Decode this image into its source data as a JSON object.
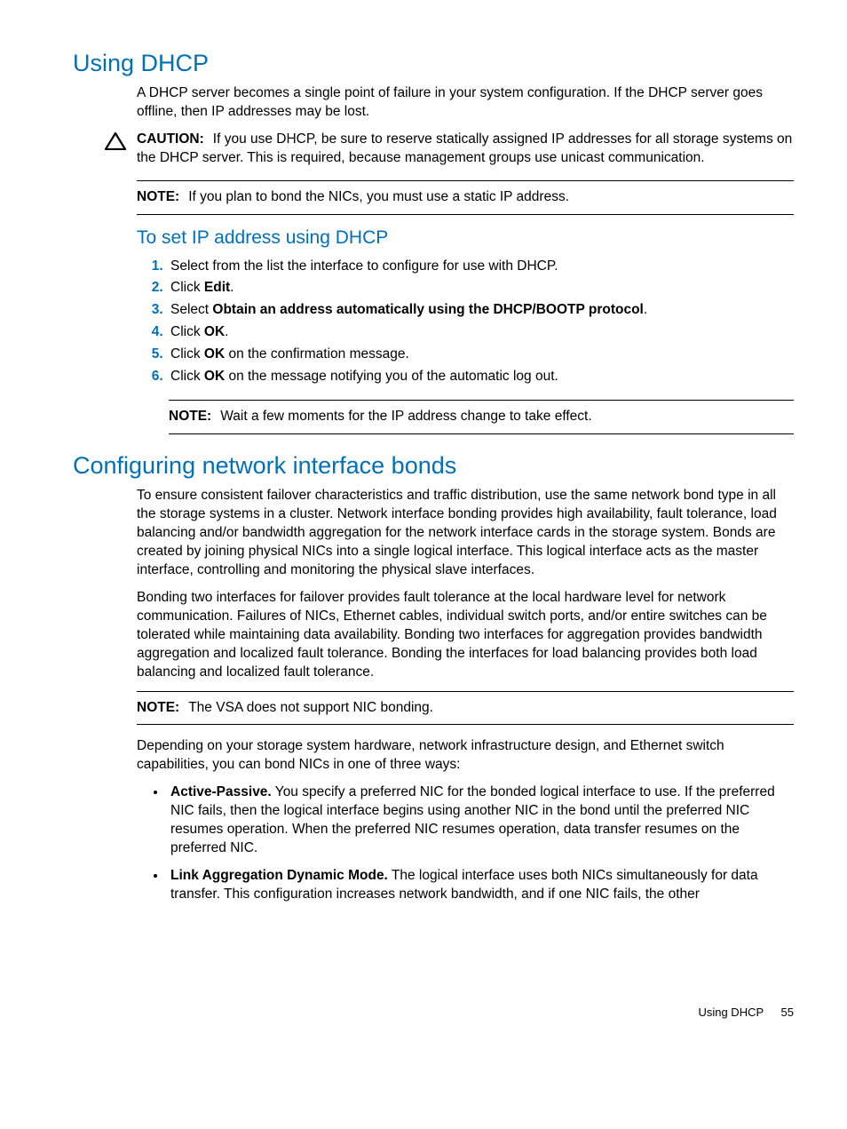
{
  "section1": {
    "heading": "Using DHCP",
    "intro": "A DHCP server becomes a single point of failure in your system configuration. If the DHCP server goes offline, then IP addresses may be lost.",
    "caution_label": "CAUTION:",
    "caution_text": "If you use DHCP, be sure to reserve statically assigned IP addresses for all storage systems on the DHCP server. This is required, because management groups use unicast communication.",
    "note1_label": "NOTE:",
    "note1_text": "If you plan to bond the NICs, you must use a static IP address.",
    "subheading": "To set IP address using DHCP",
    "steps": {
      "s1": "Select from the list the interface to configure for use with DHCP.",
      "s2a": "Click ",
      "s2b": "Edit",
      "s2c": ".",
      "s3a": "Select ",
      "s3b": "Obtain an address automatically using the DHCP/BOOTP protocol",
      "s3c": ".",
      "s4a": "Click ",
      "s4b": "OK",
      "s4c": ".",
      "s5a": "Click ",
      "s5b": "OK",
      "s5c": " on the confirmation message.",
      "s6a": "Click ",
      "s6b": "OK",
      "s6c": " on the message notifying you of the automatic log out."
    },
    "note2_label": "NOTE:",
    "note2_text": "Wait a few moments for the IP address change to take effect."
  },
  "section2": {
    "heading": "Configuring network interface bonds",
    "p1": "To ensure consistent failover characteristics and traffic distribution, use the same network bond type in all the storage systems in a cluster. Network interface bonding provides high availability, fault tolerance, load balancing and/or bandwidth aggregation for the network interface cards in the storage system. Bonds are created by joining physical NICs into a single logical interface. This logical interface acts as the master interface, controlling and monitoring the physical slave interfaces.",
    "p2": "Bonding two interfaces for failover provides fault tolerance at the local hardware level for network communication. Failures of NICs, Ethernet cables, individual switch ports, and/or entire switches can be tolerated while maintaining data availability. Bonding two interfaces for aggregation provides bandwidth aggregation and localized fault tolerance. Bonding the interfaces for load balancing provides both load balancing and localized fault tolerance.",
    "note_label": "NOTE:",
    "note_text": "The VSA does not support NIC bonding.",
    "p3": "Depending on your storage system hardware, network infrastructure design, and Ethernet switch capabilities, you can bond NICs in one of three ways:",
    "bullets": {
      "b1_label": "Active-Passive.",
      "b1_text": " You specify a preferred NIC for the bonded logical interface to use. If the preferred NIC fails, then the logical interface begins using another NIC in the bond until the preferred NIC resumes operation. When the preferred NIC resumes operation, data transfer resumes on the preferred NIC.",
      "b2_label": "Link Aggregation Dynamic Mode.",
      "b2_text": " The logical interface uses both NICs simultaneously for data transfer. This configuration increases network bandwidth, and if one NIC fails, the other"
    }
  },
  "footer": {
    "text": "Using DHCP",
    "page": "55"
  }
}
